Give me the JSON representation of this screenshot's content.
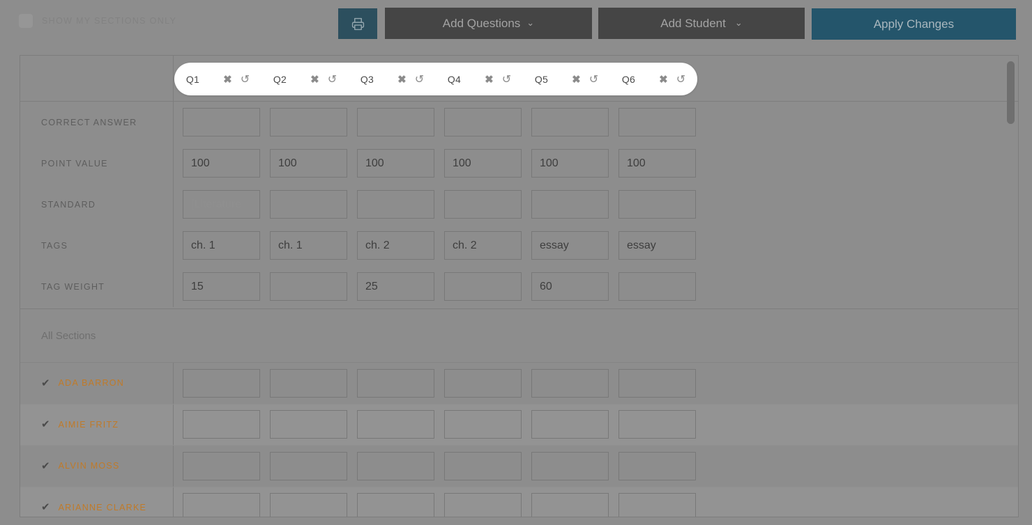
{
  "toolbar": {
    "show_sections_label": "SHOW MY SECTIONS ONLY",
    "print_icon": "printer-icon",
    "add_questions_label": "Add Questions",
    "add_student_label": "Add Student",
    "apply_changes_label": "Apply Changes",
    "caret_glyph": "⌄",
    "colors": {
      "print_button": "#2c4f5e",
      "dark_button": "#454545",
      "apply_button": "#24556b",
      "overlay": "#8d8d8d",
      "student_name": "#c07a28"
    }
  },
  "question_bar": {
    "questions": [
      {
        "label": "Q1",
        "remove_icon": "close-icon",
        "reset_icon": "undo-icon"
      },
      {
        "label": "Q2",
        "remove_icon": "close-icon",
        "reset_icon": "undo-icon"
      },
      {
        "label": "Q3",
        "remove_icon": "close-icon",
        "reset_icon": "undo-icon"
      },
      {
        "label": "Q4",
        "remove_icon": "close-icon",
        "reset_icon": "undo-icon"
      },
      {
        "label": "Q5",
        "remove_icon": "close-icon",
        "reset_icon": "undo-icon"
      },
      {
        "label": "Q6",
        "remove_icon": "close-icon",
        "reset_icon": "undo-icon"
      }
    ],
    "remove_glyph": "✖",
    "reset_glyph": "↺"
  },
  "attribute_rows": [
    {
      "label": "CORRECT ANSWER",
      "values": [
        "",
        "",
        "",
        "",
        "",
        ""
      ],
      "placeholders": [
        "",
        "",
        "",
        "",
        "",
        ""
      ]
    },
    {
      "label": "POINT VALUE",
      "values": [
        "100",
        "100",
        "100",
        "100",
        "100",
        "100"
      ],
      "placeholders": [
        "",
        "",
        "",
        "",
        "",
        ""
      ]
    },
    {
      "label": "STANDARD",
      "values": [
        "",
        "",
        "",
        "",
        "",
        ""
      ],
      "placeholders": [
        "[Literature",
        "",
        "",
        "",
        "",
        ""
      ]
    },
    {
      "label": "TAGS",
      "values": [
        "ch. 1",
        "ch. 1",
        "ch. 2",
        "ch. 2",
        "essay",
        "essay"
      ],
      "placeholders": [
        "",
        "",
        "",
        "",
        "",
        ""
      ]
    },
    {
      "label": "TAG WEIGHT",
      "values": [
        "15",
        "",
        "25",
        "",
        "60",
        ""
      ],
      "placeholders": [
        "",
        "",
        "",
        "",
        "",
        ""
      ]
    }
  ],
  "section_group": {
    "label": "All Sections"
  },
  "students": [
    {
      "name": "ADA BARRON",
      "checked": true,
      "check_glyph": "✔",
      "scores": [
        "",
        "",
        "",
        "",
        "",
        ""
      ]
    },
    {
      "name": "AIMIE FRITZ",
      "checked": true,
      "check_glyph": "✔",
      "scores": [
        "",
        "",
        "",
        "",
        "",
        ""
      ]
    },
    {
      "name": "ALVIN MOSS",
      "checked": true,
      "check_glyph": "✔",
      "scores": [
        "",
        "",
        "",
        "",
        "",
        ""
      ]
    },
    {
      "name": "ARIANNE CLARKE",
      "checked": true,
      "check_glyph": "✔",
      "scores": [
        "",
        "",
        "",
        "",
        "",
        ""
      ]
    }
  ],
  "scrollbar": {
    "name": "vertical-scrollbar"
  }
}
